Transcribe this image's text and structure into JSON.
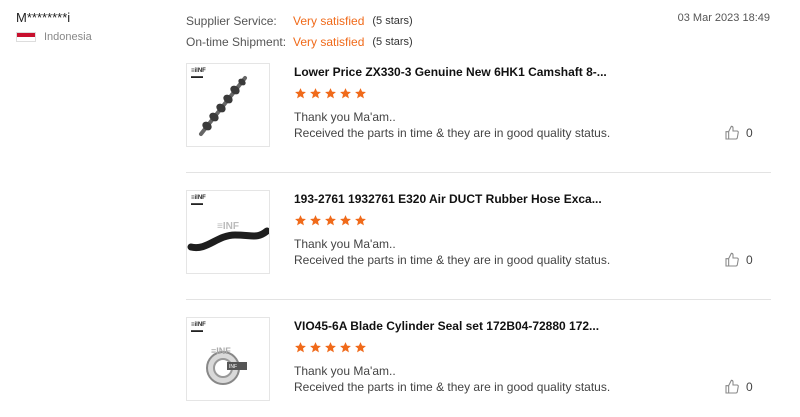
{
  "reviewer": {
    "name": "M********i",
    "country": "Indonesia",
    "flag_colors": [
      "#c8102e",
      "#ffffff"
    ]
  },
  "ratings": [
    {
      "label": "Supplier Service:",
      "value": "Very satisfied",
      "stars": "(5 stars)"
    },
    {
      "label": "On-time Shipment:",
      "value": "Very satisfied",
      "stars": "(5 stars)"
    }
  ],
  "date": "03 Mar 2023 18:49",
  "accent_color": "#f06a1a",
  "items": [
    {
      "title": "Lower Price ZX330-3 Genuine New 6HK1 Camshaft 8-...",
      "rating": 5,
      "line1": "Thank you Ma'am..",
      "line2": "Received the parts in time & they are in good quality status.",
      "likes": "0",
      "thumb_icon": "camshaft-image"
    },
    {
      "title": "193-2761 1932761 E320 Air DUCT Rubber Hose Exca...",
      "rating": 5,
      "line1": "Thank you Ma'am..",
      "line2": "Received the parts in time & they are in good quality status.",
      "likes": "0",
      "thumb_icon": "rubber-hose-image"
    },
    {
      "title": "VIO45-6A Blade Cylinder Seal set 172B04-72880 172...",
      "rating": 5,
      "line1": "Thank you Ma'am..",
      "line2": "Received the parts in time & they are in good quality status.",
      "likes": "0",
      "thumb_icon": "seal-set-image"
    }
  ]
}
